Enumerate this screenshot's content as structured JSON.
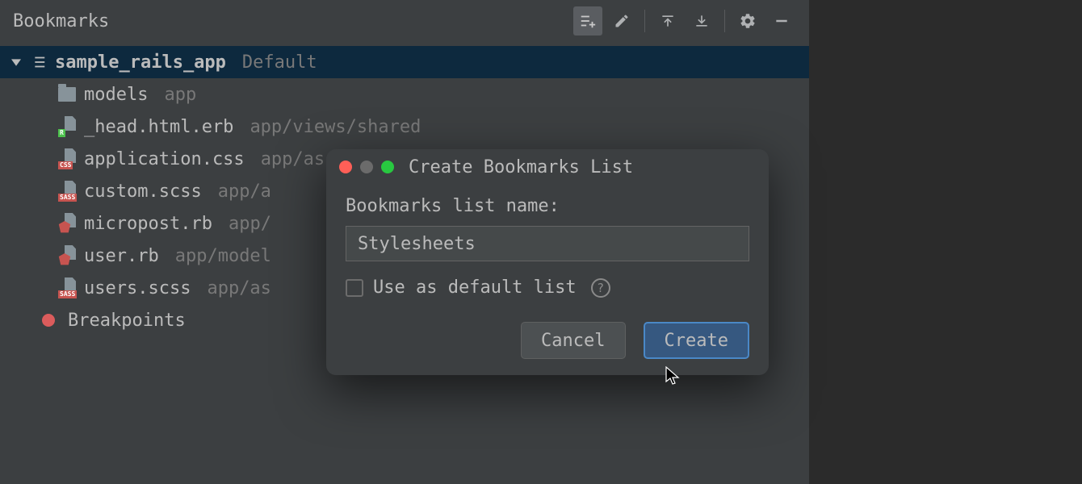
{
  "panel": {
    "title": "Bookmarks"
  },
  "tree": {
    "root": {
      "label": "sample_rails_app",
      "badge": "Default"
    },
    "items": [
      {
        "name": "models",
        "path": "app",
        "icon": "folder"
      },
      {
        "name": "_head.html.erb",
        "path": "app/views/shared",
        "icon": "r"
      },
      {
        "name": "application.css",
        "path": "app/assets/stylesheets",
        "icon": "css"
      },
      {
        "name": "custom.scss",
        "path": "app/a",
        "icon": "sass"
      },
      {
        "name": "micropost.rb",
        "path": "app/",
        "icon": "ruby"
      },
      {
        "name": "user.rb",
        "path": "app/model",
        "icon": "ruby"
      },
      {
        "name": "users.scss",
        "path": "app/as",
        "icon": "sass"
      }
    ],
    "breakpoints_label": "Breakpoints"
  },
  "dialog": {
    "title": "Create Bookmarks List",
    "label": "Bookmarks list name:",
    "input_value": "Stylesheets",
    "checkbox_label": "Use as default list",
    "cancel": "Cancel",
    "create": "Create"
  }
}
